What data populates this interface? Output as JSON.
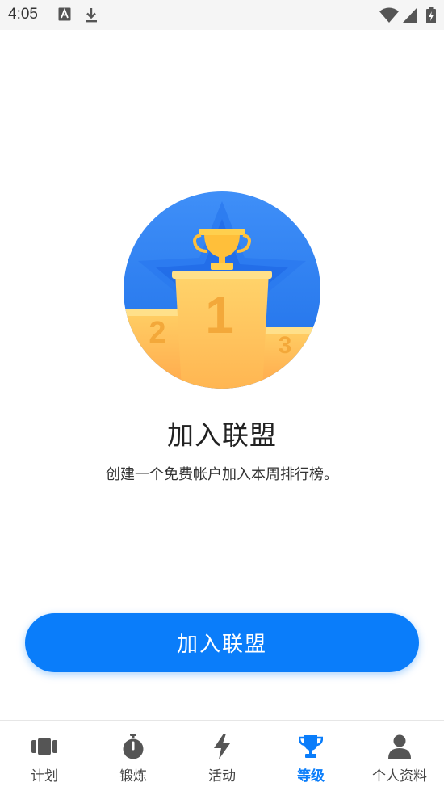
{
  "status_bar": {
    "time": "4:05"
  },
  "hero": {
    "first_place": "1",
    "second_place": "2",
    "third_place": "3"
  },
  "content": {
    "title": "加入联盟",
    "subtitle": "创建一个免费帐户加入本周排行榜。"
  },
  "action": {
    "join_label": "加入联盟"
  },
  "nav": {
    "items": [
      {
        "label": "计划",
        "icon": "plan-icon",
        "active": false
      },
      {
        "label": "锻炼",
        "icon": "stopwatch-icon",
        "active": false
      },
      {
        "label": "活动",
        "icon": "lightning-icon",
        "active": false
      },
      {
        "label": "等级",
        "icon": "trophy-icon",
        "active": true
      },
      {
        "label": "个人资料",
        "icon": "person-icon",
        "active": false
      }
    ]
  },
  "colors": {
    "accent": "#0a7dfa",
    "podium": "#ffc95a",
    "hero_bg": "#2f7ff5"
  }
}
